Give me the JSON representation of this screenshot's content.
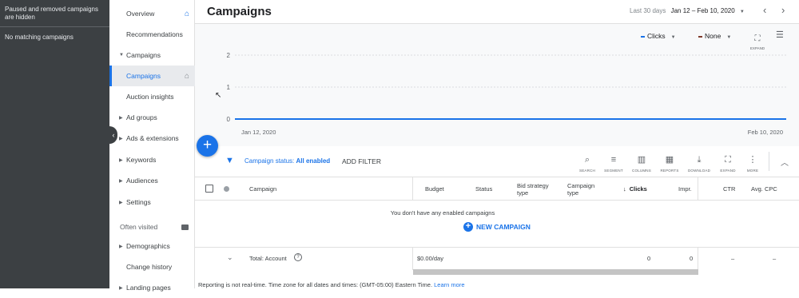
{
  "left_panel": {
    "hidden_message": "Paused and removed campaigns are hidden",
    "no_match": "No matching campaigns",
    "collapse_icon": "chevron-left-icon"
  },
  "nav": {
    "items": [
      {
        "label": "Overview",
        "icon": "home-icon"
      },
      {
        "label": "Recommendations"
      },
      {
        "label": "Campaigns",
        "expanded": true
      },
      {
        "label": "Campaigns",
        "active": true,
        "icon": "home-icon"
      },
      {
        "label": "Auction insights"
      },
      {
        "label": "Ad groups"
      },
      {
        "label": "Ads & extensions"
      },
      {
        "label": "Keywords"
      },
      {
        "label": "Audiences"
      },
      {
        "label": "Settings"
      },
      {
        "label": "Often visited",
        "section": true
      },
      {
        "label": "Demographics"
      },
      {
        "label": "Change history"
      },
      {
        "label": "Landing pages"
      }
    ]
  },
  "header": {
    "title": "Campaigns",
    "range_label": "Last 30 days",
    "range": "Jan 12 – Feb 10, 2020"
  },
  "chart_controls": {
    "metric1": "Clicks",
    "metric1_color": "#1a73e8",
    "metric2": "None",
    "metric2_color": "#7f3a2b",
    "expand_label": "EXPAND"
  },
  "chart_data": {
    "type": "line",
    "x": [
      "Jan 12, 2020",
      "Feb 10, 2020"
    ],
    "series": [
      {
        "values": [
          0,
          0
        ],
        "color": "#1a73e8"
      }
    ],
    "yticks": [
      "2",
      "1",
      "0"
    ],
    "ylim": [
      0,
      2
    ],
    "xlabel_start": "Jan 12, 2020",
    "xlabel_end": "Feb 10, 2020",
    "grid": true
  },
  "filter": {
    "status_label": "Campaign status:",
    "status_value": "All enabled",
    "add_filter": "ADD FILTER"
  },
  "toolbar": {
    "search": "SEARCH",
    "segment": "SEGMENT",
    "columns": "COLUMNS",
    "reports": "REPORTS",
    "download": "DOWNLOAD",
    "expand": "EXPAND",
    "more": "MORE"
  },
  "table": {
    "headers": {
      "campaign": "Campaign",
      "budget": "Budget",
      "status": "Status",
      "bid_strategy": "Bid strategy type",
      "campaign_type": "Campaign type",
      "clicks": "Clicks",
      "impr": "Impr.",
      "ctr": "CTR",
      "avg_cpc": "Avg. CPC"
    },
    "empty_message": "You don't have any enabled campaigns",
    "new_campaign": "NEW CAMPAIGN",
    "total": {
      "label": "Total: Account",
      "budget": "$0.00/day",
      "clicks": "0",
      "impr": "0",
      "ctr": "–",
      "avg_cpc": "–"
    }
  },
  "footer": {
    "text": "Reporting is not real-time. Time zone for all dates and times: (GMT-05:00) Eastern Time.",
    "link": "Learn more"
  }
}
